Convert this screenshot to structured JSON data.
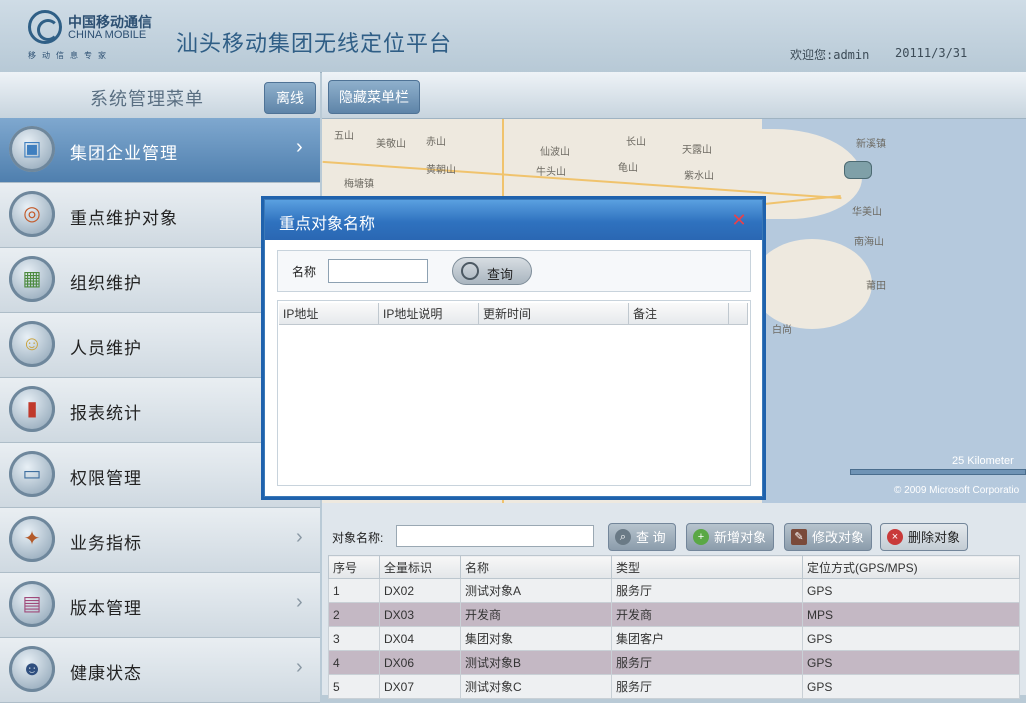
{
  "header": {
    "logo_cn": "中国移动通信",
    "logo_en": "CHINA MOBILE",
    "logo_slogan": "移动信息专家",
    "title": "汕头移动集团无线定位平台",
    "welcome": "欢迎您:admin",
    "date": "20111/3/31"
  },
  "sidebar": {
    "title": "系统管理菜单",
    "offline_label": "离线",
    "items": [
      {
        "label": "集团企业管理",
        "icon": "building-icon",
        "active": true
      },
      {
        "label": "重点维护对象",
        "icon": "target-icon"
      },
      {
        "label": "组织维护",
        "icon": "org-icon"
      },
      {
        "label": "人员维护",
        "icon": "user-icon"
      },
      {
        "label": "报表统计",
        "icon": "bar-chart-icon"
      },
      {
        "label": "权限管理",
        "icon": "monitor-icon"
      },
      {
        "label": "业务指标",
        "icon": "compass-icon"
      },
      {
        "label": "版本管理",
        "icon": "book-icon"
      },
      {
        "label": "健康状态",
        "icon": "person-icon"
      }
    ]
  },
  "topbar": {
    "hide_menu_label": "隐藏菜单栏"
  },
  "map": {
    "labels": [
      "五山",
      "美敬山",
      "仙波山",
      "长山",
      "天露山",
      "新溪镇",
      "梅塘镇",
      "黄朝山",
      "龟山",
      "赤山",
      "牛头山",
      "紫水山",
      "华美山",
      "南海山",
      "白尚",
      "莆田"
    ],
    "scale": "25 Kilometer",
    "copyright": "© 2009 Microsoft Corporatio"
  },
  "modal": {
    "title": "重点对象名称",
    "name_label": "名称",
    "name_value": "",
    "query_label": "查询",
    "columns": [
      "IP地址",
      "IP地址说明",
      "更新时间",
      "备注"
    ]
  },
  "objects": {
    "search_label": "对象名称:",
    "search_value": "",
    "query_label": "查 询",
    "add_label": "新增对象",
    "edit_label": "修改对象",
    "delete_label": "删除对象",
    "columns": [
      "序号",
      "全量标识",
      "名称",
      "类型",
      "定位方式(GPS/MPS)"
    ],
    "rows": [
      [
        "1",
        "DX02",
        "测试对象A",
        "服务厅",
        "GPS"
      ],
      [
        "2",
        "DX03",
        "开发商",
        "开发商",
        "MPS"
      ],
      [
        "3",
        "DX04",
        "集团对象",
        "集团客户",
        "GPS"
      ],
      [
        "4",
        "DX06",
        "测试对象B",
        "服务厅",
        "GPS"
      ],
      [
        "5",
        "DX07",
        "测试对象C",
        "服务厅",
        "GPS"
      ]
    ]
  },
  "colors": {
    "accent": "#2f72bf",
    "close": "#e8414b",
    "delete": "#c93a3a",
    "add": "#5aa845"
  }
}
